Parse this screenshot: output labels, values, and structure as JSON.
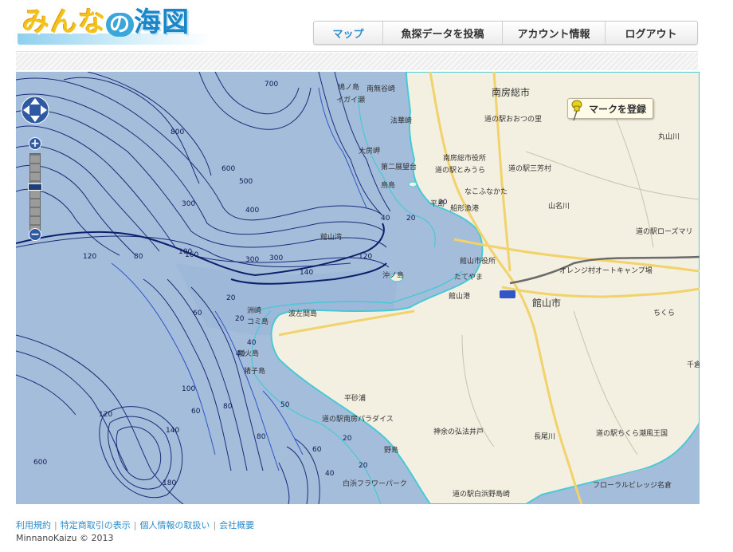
{
  "logo": {
    "part1": "みんな",
    "part2": "の",
    "part3": "海図"
  },
  "nav": {
    "items": [
      "マップ",
      "魚探データを投稿",
      "アカウント情報",
      "ログアウト"
    ]
  },
  "map": {
    "mark_button": "マークを登録",
    "zoom_in": "+",
    "zoom_out": "−",
    "colors": {
      "sea_deep": "#a4bddb",
      "sea_shallow": "#9db8d8",
      "land": "#f3efe1",
      "contour": "#1c2c78",
      "coast": "#48c9d6",
      "road": "#f2d26a"
    },
    "place_labels": [
      {
        "text": "南房総市"
      },
      {
        "text": "館山市"
      },
      {
        "text": "道の駅おおつの里"
      },
      {
        "text": "道の駅とみうら"
      },
      {
        "text": "南房総市役所"
      },
      {
        "text": "道の駅三芳村"
      },
      {
        "text": "なこふなかた"
      },
      {
        "text": "船形漁港"
      },
      {
        "text": "館山市役所"
      },
      {
        "text": "たてやま"
      },
      {
        "text": "館山港"
      },
      {
        "text": "オレンジ村オートキャンプ場"
      },
      {
        "text": "道の駅ローズマリ"
      },
      {
        "text": "千倉漁港"
      },
      {
        "text": "道の駅ちくら潮風王国"
      },
      {
        "text": "フローラルビレッジ名倉"
      },
      {
        "text": "神余の弘法井戸"
      },
      {
        "text": "長尾川"
      },
      {
        "text": "道の駅南房パラダイス"
      },
      {
        "text": "平砂浦"
      },
      {
        "text": "野島"
      },
      {
        "text": "白浜フラワーパーク"
      },
      {
        "text": "道の駅白浜野島崎"
      },
      {
        "text": "丸山川"
      },
      {
        "text": "山名川"
      },
      {
        "text": "ちくら"
      },
      {
        "text": "大房岬"
      },
      {
        "text": "第二展望台"
      },
      {
        "text": "鳥島"
      },
      {
        "text": "平島"
      },
      {
        "text": "法華崎"
      },
      {
        "text": "南無谷崎"
      },
      {
        "text": "イガイ瀬"
      },
      {
        "text": "館山湾"
      },
      {
        "text": "沖ノ島"
      },
      {
        "text": "洲崎"
      },
      {
        "text": "コミ島"
      },
      {
        "text": "波左間島"
      },
      {
        "text": "割火島"
      },
      {
        "text": "猪子島"
      },
      {
        "text": "410"
      },
      {
        "text": "鳩ノ島"
      }
    ],
    "depth_labels": [
      {
        "text": "700"
      },
      {
        "text": "800"
      },
      {
        "text": "600"
      },
      {
        "text": "500"
      },
      {
        "text": "400"
      },
      {
        "text": "300"
      },
      {
        "text": "300"
      },
      {
        "text": "300"
      },
      {
        "text": "160"
      },
      {
        "text": "140"
      },
      {
        "text": "120"
      },
      {
        "text": "120"
      },
      {
        "text": "80"
      },
      {
        "text": "100"
      },
      {
        "text": "60"
      },
      {
        "text": "40"
      },
      {
        "text": "20"
      },
      {
        "text": "20"
      },
      {
        "text": "20"
      },
      {
        "text": "40"
      },
      {
        "text": "20"
      },
      {
        "text": "60"
      },
      {
        "text": "80"
      },
      {
        "text": "100"
      },
      {
        "text": "140"
      },
      {
        "text": "120"
      },
      {
        "text": "600"
      },
      {
        "text": "180"
      },
      {
        "text": "80"
      },
      {
        "text": "50"
      },
      {
        "text": "20"
      },
      {
        "text": "20"
      },
      {
        "text": "40"
      },
      {
        "text": "60"
      },
      {
        "text": "40"
      }
    ]
  },
  "footer": {
    "links": [
      "利用規約",
      "特定商取引の表示",
      "個人情報の取扱い",
      "会社概要"
    ],
    "copyright": "MinnanoKaizu © 2013"
  }
}
